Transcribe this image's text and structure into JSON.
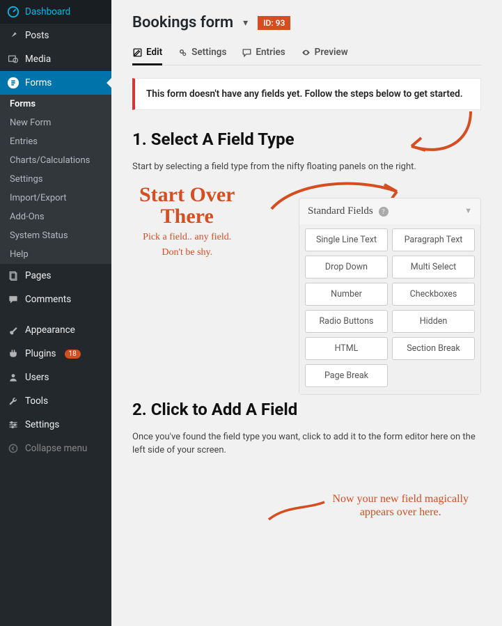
{
  "sidebar": {
    "dashboard": "Dashboard",
    "posts": "Posts",
    "media": "Media",
    "forms": "Forms",
    "submenu": [
      "Forms",
      "New Form",
      "Entries",
      "Charts/Calculations",
      "Settings",
      "Import/Export",
      "Add-Ons",
      "System Status",
      "Help"
    ],
    "pages": "Pages",
    "comments": "Comments",
    "appearance": "Appearance",
    "plugins": "Plugins",
    "plugins_badge": "18",
    "users": "Users",
    "tools": "Tools",
    "settings": "Settings",
    "collapse": "Collapse menu"
  },
  "header": {
    "title": "Bookings form",
    "id_label": "ID: 93"
  },
  "tabs": {
    "edit": "Edit",
    "settings": "Settings",
    "entries": "Entries",
    "preview": "Preview"
  },
  "notice": "This form doesn't have any fields yet. Follow the steps below to get started.",
  "section1": {
    "title": "1. Select A Field Type",
    "text": "Start by selecting a field type from the nifty floating panels on the right.",
    "hand_big_1": "Start Over",
    "hand_big_2": "There",
    "hand_small_1": "Pick a field.. any field.",
    "hand_small_2": "Don't be shy.",
    "panel_title": "Standard Fields",
    "fields": [
      "Single Line Text",
      "Paragraph Text",
      "Drop Down",
      "Multi Select",
      "Number",
      "Checkboxes",
      "Radio Buttons",
      "Hidden",
      "HTML",
      "Section Break",
      "Page Break"
    ]
  },
  "section2": {
    "title": "2. Click to Add A Field",
    "text": "Once you've found the field type you want, click to add it to the form editor here on the left side of your screen.",
    "hand_1": "Now your new field magically",
    "hand_2": "appears over here."
  }
}
